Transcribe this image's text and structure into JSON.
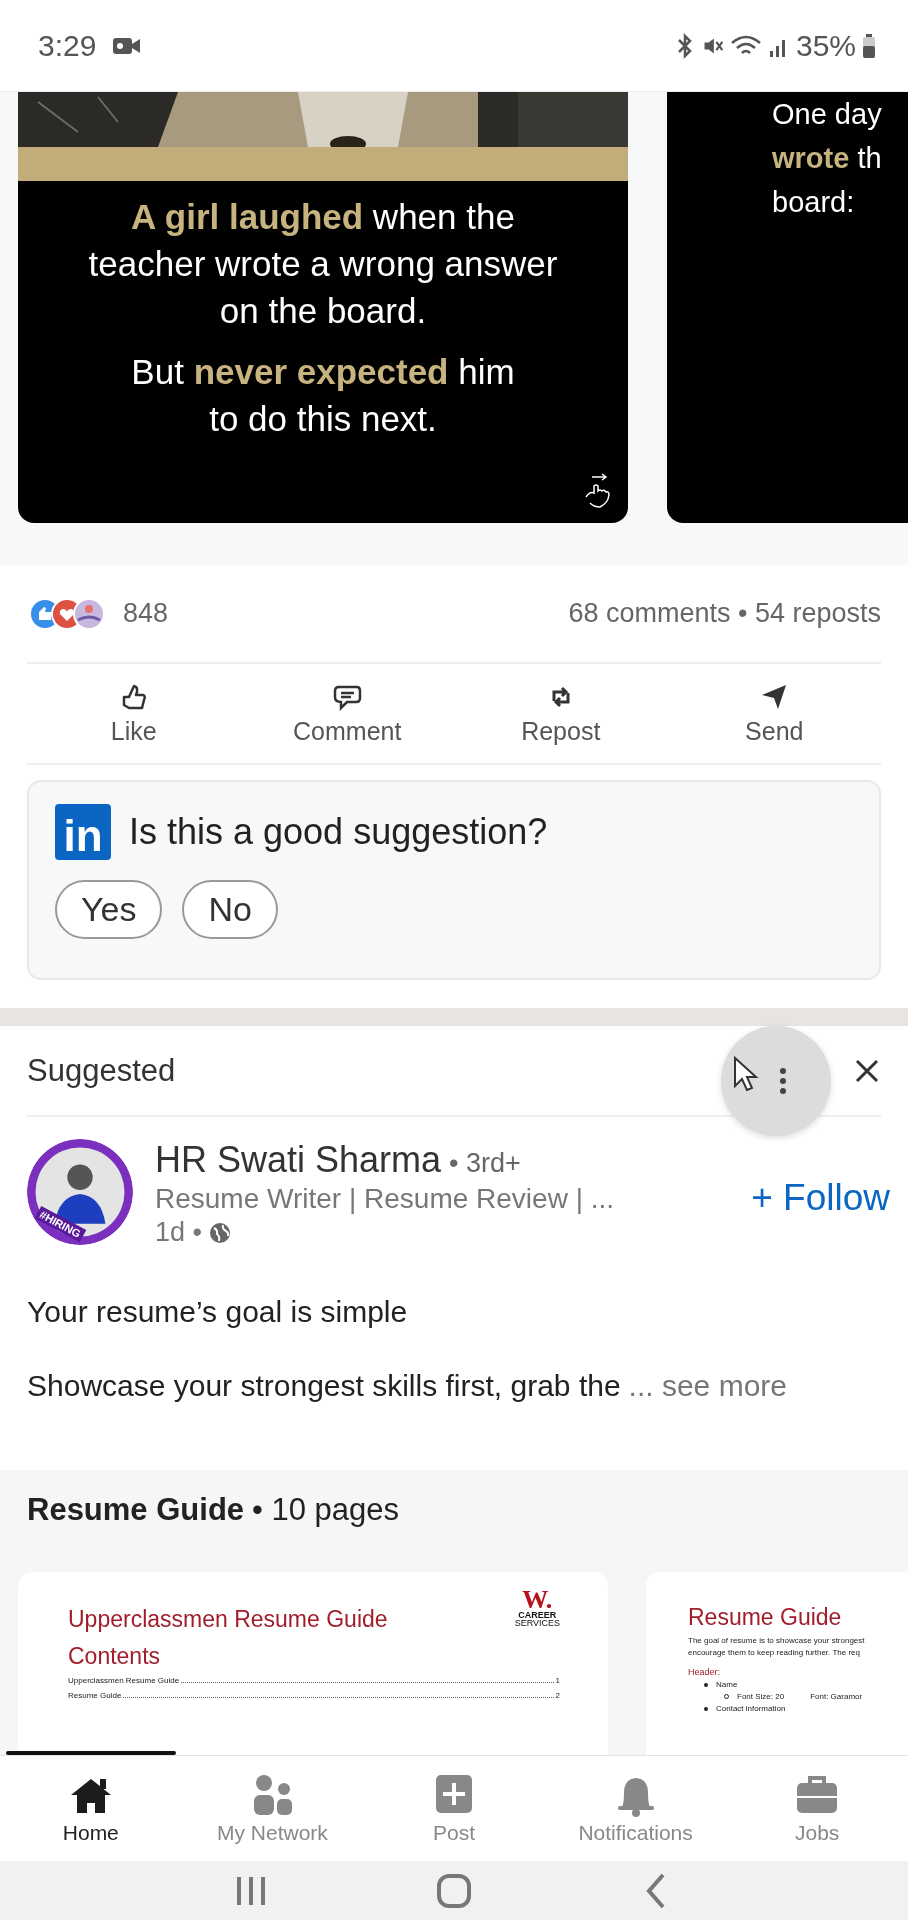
{
  "status_bar": {
    "time": "3:29",
    "battery": "35%"
  },
  "carousel": {
    "slides": [
      {
        "kind": "cover",
        "paragraphs": [
          [
            "**A girl laughed** when the",
            "teacher wrote a wrong answer",
            "on the board."
          ],
          [
            "But **never expected** him",
            "to do this next."
          ]
        ]
      },
      {
        "kind": "text",
        "lines": [
          "One day",
          "**wrote** th",
          "board:"
        ]
      }
    ]
  },
  "social": {
    "reactions": "848",
    "summary": "68 comments • 54 reposts"
  },
  "actions": [
    {
      "label": "Like",
      "kind": "like"
    },
    {
      "label": "Comment",
      "kind": "comment"
    },
    {
      "label": "Repost",
      "kind": "repost"
    },
    {
      "label": "Send",
      "kind": "send"
    }
  ],
  "feedback": {
    "logo": "in",
    "question": "Is this a good suggestion?",
    "buttons": [
      "Yes",
      "No"
    ]
  },
  "suggested_post": {
    "header": "Suggested",
    "menu_pressed": true,
    "author": {
      "name": "HR Swati Sharma",
      "degree": "• 3rd+",
      "headline": "Resume Writer | Resume Review | ...",
      "time": "1d •",
      "badge": "#HIRING"
    },
    "follow": "+ Follow",
    "body": [
      "Your resume’s goal is simple",
      "Showcase your strongest skills first, grab the"
    ],
    "see_more": "... see more",
    "document": {
      "title": "Resume Guide",
      "pages": "• 10 pages",
      "previews": [
        {
          "kind": "contents",
          "logo": [
            "W.",
            "CAREER",
            "SERVICES"
          ],
          "title": "Upperclassmen Resume Guide",
          "heading": "Contents",
          "toc": [
            {
              "entry": "Upperclassmen Resume Guide",
              "page": "1"
            },
            {
              "entry": "Resume Guide",
              "page": "2"
            }
          ]
        },
        {
          "kind": "section",
          "title": "Resume Guide",
          "intro": [
            "The goal of resume is to showcase your strongest",
            "encourage them to keep reading further. The req"
          ],
          "heading": "Header:",
          "bullets": [
            {
              "text": "Name",
              "children": [
                {
                  "text": "Font Size: 20",
                  "note": "Font: Garamor"
                }
              ]
            },
            {
              "text": "Contact information"
            }
          ]
        }
      ]
    }
  },
  "bottom_nav": [
    {
      "label": "Home",
      "kind": "home",
      "selected": true
    },
    {
      "label": "My Network",
      "kind": "network",
      "selected": false
    },
    {
      "label": "Post",
      "kind": "post",
      "selected": false
    },
    {
      "label": "Notifications",
      "kind": "bell",
      "selected": false
    },
    {
      "label": "Jobs",
      "kind": "jobs",
      "selected": false
    }
  ]
}
